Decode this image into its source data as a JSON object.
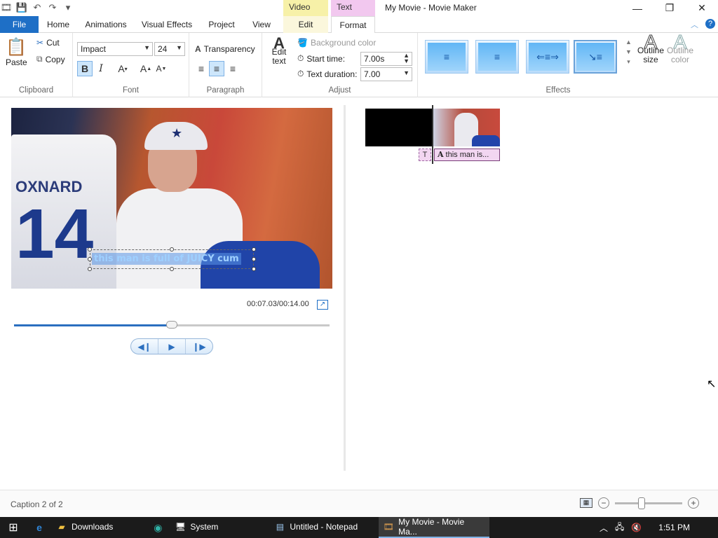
{
  "window": {
    "title": "My Movie - Movie Maker",
    "contextual_tabs": {
      "video_tools": "Video Tools",
      "text_tools": "Text Tools"
    }
  },
  "ribbon_tabs": {
    "file": "File",
    "home": "Home",
    "animations": "Animations",
    "visual_effects": "Visual Effects",
    "project": "Project",
    "view": "View",
    "edit": "Edit",
    "format": "Format"
  },
  "clipboard": {
    "paste": "Paste",
    "cut": "Cut",
    "copy": "Copy",
    "label": "Clipboard"
  },
  "font": {
    "family": "Impact",
    "size": "24",
    "label": "Font"
  },
  "paragraph": {
    "transparency": "Transparency",
    "label": "Paragraph"
  },
  "adjust": {
    "edit_text": "Edit text",
    "background_color": "Background color",
    "start_time_label": "Start time:",
    "start_time_value": "7.00s",
    "text_duration_label": "Text duration:",
    "text_duration_value": "7.00",
    "label": "Adjust"
  },
  "effects": {
    "label": "Effects",
    "outline_size": "Outline size",
    "outline_color": "Outline color"
  },
  "preview": {
    "caption": "this man is full of JUICY cum",
    "jersey_name": "OXNARD",
    "jersey_number": "14",
    "timecode": "00:07.03/00:14.00",
    "progress": 0.5
  },
  "storyboard": {
    "caption_short": "T",
    "caption_clip": "this man is..."
  },
  "status": {
    "caption_count": "Caption 2 of 2",
    "zoom_level": 0.4
  },
  "taskbar": {
    "items": [
      {
        "label": "Downloads"
      },
      {
        "label": "System"
      },
      {
        "label": "Untitled - Notepad"
      },
      {
        "label": "My Movie - Movie Ma..."
      }
    ],
    "clock": "1:51 PM"
  },
  "colors": {
    "accent": "#1e6fc6",
    "video_tools": "#f7f1a8",
    "text_tools": "#f2c8ef"
  }
}
